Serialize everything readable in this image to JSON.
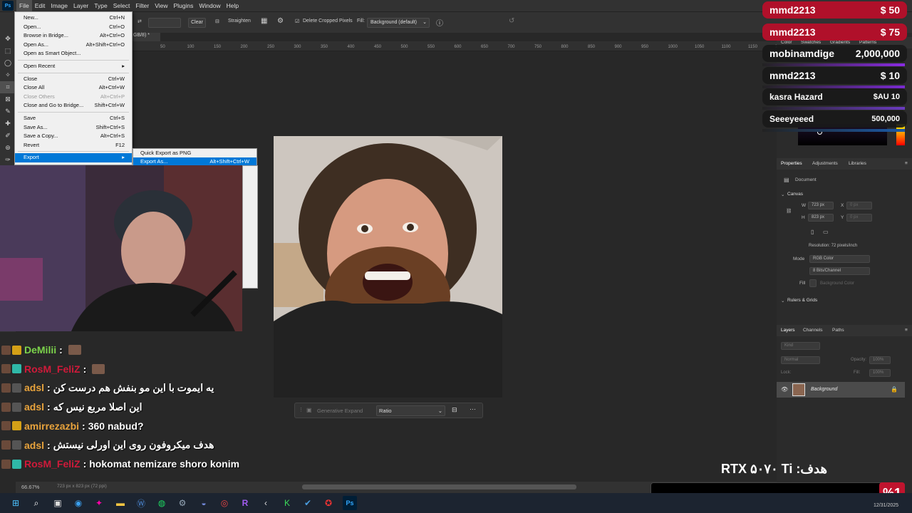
{
  "menubar": {
    "items": [
      "File",
      "Edit",
      "Image",
      "Layer",
      "Type",
      "Select",
      "Filter",
      "View",
      "Plugins",
      "Window",
      "Help"
    ]
  },
  "options": {
    "clear": "Clear",
    "straighten": "Straighten",
    "delete_cropped": "Delete Cropped Pixels",
    "fill_label": "Fill:",
    "fill_value": "Background (default)"
  },
  "doc_tab": "GB/8) *",
  "ruler_ticks": [
    "50",
    "100",
    "150",
    "200",
    "250",
    "300",
    "350",
    "400",
    "450",
    "500",
    "550",
    "600",
    "650",
    "700",
    "750",
    "800",
    "850",
    "900",
    "950",
    "1000",
    "1050",
    "1100",
    "1150",
    "1200"
  ],
  "file_menu": {
    "items": [
      {
        "label": "New...",
        "shortcut": "Ctrl+N"
      },
      {
        "label": "Open...",
        "shortcut": "Ctrl+O"
      },
      {
        "label": "Browse in Bridge...",
        "shortcut": "Alt+Ctrl+O"
      },
      {
        "label": "Open As...",
        "shortcut": "Alt+Shift+Ctrl+O"
      },
      {
        "label": "Open as Smart Object...",
        "shortcut": ""
      },
      {
        "label": "Open Recent",
        "shortcut": "▸"
      },
      {
        "label": "Close",
        "shortcut": "Ctrl+W"
      },
      {
        "label": "Close All",
        "shortcut": "Alt+Ctrl+W"
      },
      {
        "label": "Close Others",
        "shortcut": "Alt+Ctrl+P"
      },
      {
        "label": "Close and Go to Bridge...",
        "shortcut": "Shift+Ctrl+W"
      },
      {
        "label": "Save",
        "shortcut": "Ctrl+S"
      },
      {
        "label": "Save As...",
        "shortcut": "Shift+Ctrl+S"
      },
      {
        "label": "Save a Copy...",
        "shortcut": "Alt+Ctrl+S"
      },
      {
        "label": "Revert",
        "shortcut": "F12"
      },
      {
        "label": "Export",
        "shortcut": "▸"
      }
    ],
    "submenu": [
      {
        "label": "Quick Export as PNG",
        "shortcut": ""
      },
      {
        "label": "Export As...",
        "shortcut": "Alt+Shift+Ctrl+W"
      }
    ]
  },
  "context_bar": {
    "generative_expand": "Generative Expand",
    "ratio": "Ratio",
    "more": "···"
  },
  "status": {
    "zoom": "66.67%",
    "dimensions": "723 px x 823 px (72 ppi)"
  },
  "panels": {
    "top_tabs": [
      "Color",
      "Swatches",
      "Gradients",
      "Patterns"
    ],
    "properties_tabs": [
      "Properties",
      "Adjustments",
      "Libraries"
    ],
    "document": "Document",
    "canvas_section": "Canvas",
    "w_label": "W",
    "w_value": "723 px",
    "h_label": "H",
    "h_value": "823 px",
    "x_label": "X",
    "x_value": "0 px",
    "y_label": "Y",
    "y_value": "0 px",
    "resolution": "Resolution: 72 pixels/inch",
    "mode_label": "Mode",
    "mode_value": "RGB Color",
    "depth_value": "8 Bits/Channel",
    "fill_label": "Fill",
    "fill_value": "Background Color",
    "rulers_section": "Rulers & Grids",
    "layers_tabs": [
      "Layers",
      "Channels",
      "Paths"
    ],
    "kind_placeholder": "Kind",
    "blend_mode": "Normal",
    "opacity_label": "Opacity:",
    "opacity_value": "100%",
    "lock_label": "Lock:",
    "fill2_label": "Fill:",
    "fill2_value": "100%",
    "layer_name": "Background"
  },
  "chat": [
    {
      "user": "DeMilii",
      "color": "#7cd34b",
      "message": "",
      "badge": "#d4a017"
    },
    {
      "user": "RosM_FeliZ",
      "color": "#d01a3a",
      "message": "",
      "badge": "#2fb8a8"
    },
    {
      "user": "adsl",
      "color": "#e8a33c",
      "message": "یه ایموت با این مو بنفش هم درست کن",
      "badge": "#555"
    },
    {
      "user": "adsl",
      "color": "#e8a33c",
      "message": "این اصلا مربع نیس که",
      "badge": "#555"
    },
    {
      "user": "amirrezazbi",
      "color": "#e8a33c",
      "message": "360 nabud?",
      "badge": "#d4a017"
    },
    {
      "user": "adsl",
      "color": "#e8a33c",
      "message": "هدف میکروفون روی این اورلی نیستش",
      "badge": "#555"
    },
    {
      "user": "RosM_FeliZ",
      "color": "#d01a3a",
      "message": "hokomat nemizare shoro konim",
      "badge": "#2fb8a8"
    }
  ],
  "donations": [
    {
      "name": "mmd2213",
      "amount": "$ 50",
      "style": "red"
    },
    {
      "name": "mmd2213",
      "amount": "$ 75",
      "style": "red"
    },
    {
      "name": "mobinamdige",
      "amount": "2,000,000",
      "style": "dark"
    },
    {
      "name": "mmd2213",
      "amount": "$ 10",
      "style": "dark"
    },
    {
      "name": "kasra Hazard",
      "amount": "$AU 10",
      "style": "dark"
    },
    {
      "name": "Seeeyeeed",
      "amount": "500,000",
      "style": "dark"
    }
  ],
  "goal": {
    "text": "RTX ۵۰۷۰ Ti :هدف",
    "percent": "%1"
  },
  "taskbar": {
    "date": "12/31/2025"
  }
}
